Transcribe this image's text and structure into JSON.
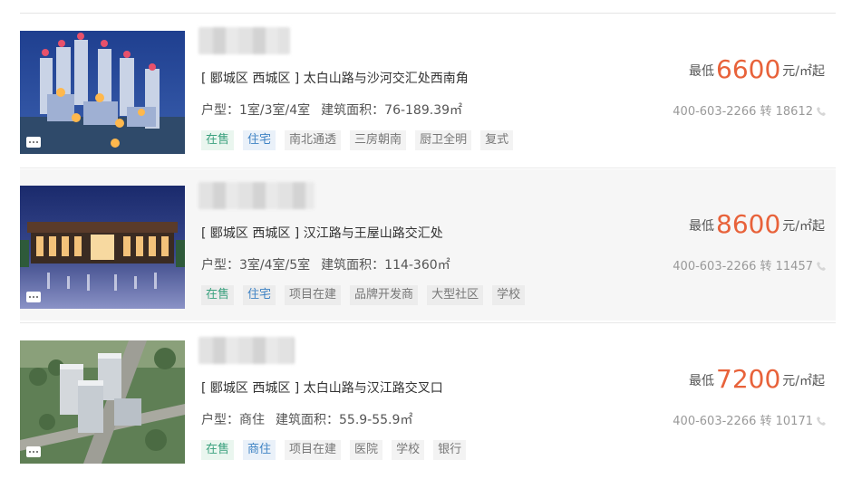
{
  "listings": [
    {
      "address": "[ 郾城区 西城区 ] 太白山路与沙河交汇处西南角",
      "layout_label": "户型：",
      "layout_value": "1室/3室/4室",
      "area_label": "建筑面积：",
      "area_value": "76-189.39㎡",
      "tags": [
        "在售",
        "住宅",
        "南北通透",
        "三房朝南",
        "厨卫全明",
        "复式"
      ],
      "price_prefix": "最低",
      "price": "6600",
      "price_unit": "元/㎡起",
      "phone": "400-603-2266 转 18612"
    },
    {
      "address": "[ 郾城区 西城区 ] 汉江路与王屋山路交汇处",
      "layout_label": "户型：",
      "layout_value": "3室/4室/5室",
      "area_label": "建筑面积：",
      "area_value": "114-360㎡",
      "tags": [
        "在售",
        "住宅",
        "项目在建",
        "品牌开发商",
        "大型社区",
        "学校"
      ],
      "price_prefix": "最低",
      "price": "8600",
      "price_unit": "元/㎡起",
      "phone": "400-603-2266 转 11457"
    },
    {
      "address": "[ 郾城区 西城区 ] 太白山路与汉江路交叉口",
      "layout_label": "户型：",
      "layout_value": "商住",
      "area_label": "建筑面积：",
      "area_value": "55.9-55.9㎡",
      "tags": [
        "在售",
        "商住",
        "项目在建",
        "医院",
        "学校",
        "银行"
      ],
      "price_prefix": "最低",
      "price": "7200",
      "price_unit": "元/㎡起",
      "phone": "400-603-2266 转 10171"
    }
  ],
  "icons": {
    "comment": "comment-bubble-icon",
    "phone": "phone-icon"
  },
  "colors": {
    "price": "#e8623a",
    "tag_sale": "#3aa17e",
    "tag_type": "#3f83c4"
  }
}
